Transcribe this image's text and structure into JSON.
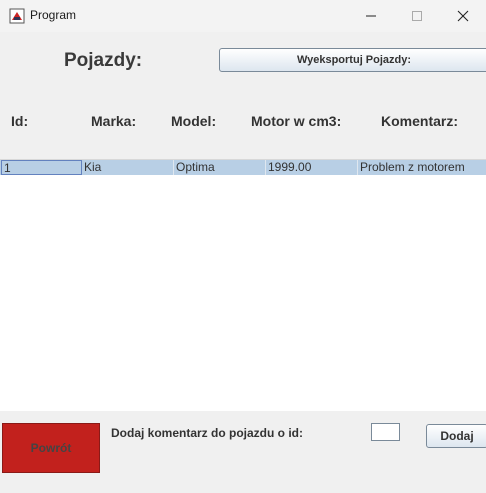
{
  "window": {
    "title": "Program"
  },
  "header": {
    "title": "Pojazdy:",
    "export_label": "Wyeksportuj Pojazdy:"
  },
  "table": {
    "columns": [
      "Id:",
      "Marka:",
      "Model:",
      "Motor w cm3:",
      "Komentarz:"
    ],
    "rows": [
      [
        "1",
        "Kia",
        "Optima",
        "1999.00",
        "Problem z motorem"
      ]
    ]
  },
  "footer": {
    "back_label": "Powrót",
    "comment_label": "Dodaj komentarz do pojazdu o id:",
    "id_value": "",
    "add_label": "Dodaj"
  },
  "colors": {
    "back_button": "#c2211d",
    "selected_row": "#b8cfe5"
  },
  "icons": [
    "java-app-icon",
    "minimize-icon",
    "maximize-icon",
    "close-icon"
  ]
}
